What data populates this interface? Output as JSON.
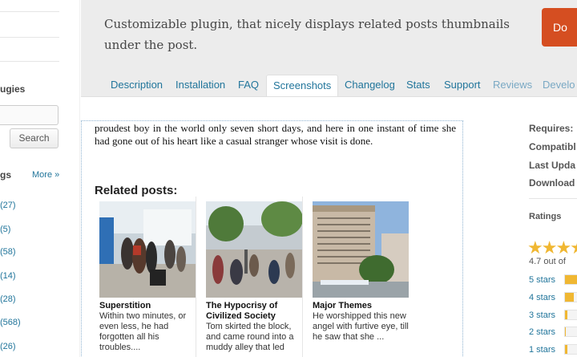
{
  "left_sidebar": {
    "heading_1": "ugies",
    "search_button": "Search",
    "heading_2": "gs",
    "more_link": "More »",
    "counts": [
      "(27)",
      "(5)",
      "(58)",
      "(14)",
      "(28)",
      "(568)",
      "(26)"
    ]
  },
  "header": {
    "tagline": "Customizable plugin, that nicely displays related posts thumbnails under the post.",
    "download_label": "Do"
  },
  "tabs": [
    {
      "label": "Description"
    },
    {
      "label": "Installation"
    },
    {
      "label": "FAQ"
    },
    {
      "label": "Screenshots",
      "active": true
    },
    {
      "label": "Changelog"
    },
    {
      "label": "Stats"
    },
    {
      "label": "Support"
    },
    {
      "label": "Reviews"
    },
    {
      "label": "Develo"
    }
  ],
  "main": {
    "excerpt": "proudest boy in the world only seven short days, and here in one instant of time she had gone out of his heart like a casual stranger whose visit is done.",
    "related_heading": "Related posts:",
    "related_posts": [
      {
        "title": "Superstition",
        "excerpt": "Within two minutes, or even less, he had forgotten all his troubles...."
      },
      {
        "title": "The Hypocrisy of Civilized Society",
        "excerpt": "Tom skirted the block, and came round into a muddy alley that led"
      },
      {
        "title": "Major Themes",
        "excerpt": "He worshipped this new angel with furtive eye, till he saw that she ..."
      }
    ]
  },
  "right_sidebar": {
    "meta_labels": [
      "Requires:",
      "Compatibl",
      "Last Upda",
      "Download"
    ],
    "ratings_title": "Ratings",
    "rating_summary": "4.7 out of",
    "star_rows": [
      {
        "label": "5 stars",
        "fill": 0.9
      },
      {
        "label": "4 stars",
        "fill": 0.4
      },
      {
        "label": "3 stars",
        "fill": 0.1
      },
      {
        "label": "2 stars",
        "fill": 0.05
      },
      {
        "label": "1 stars",
        "fill": 0.1
      }
    ]
  },
  "colors": {
    "link": "#21759b",
    "download": "#d54e21",
    "star": "#f0b732",
    "header_bg": "#ececec"
  }
}
